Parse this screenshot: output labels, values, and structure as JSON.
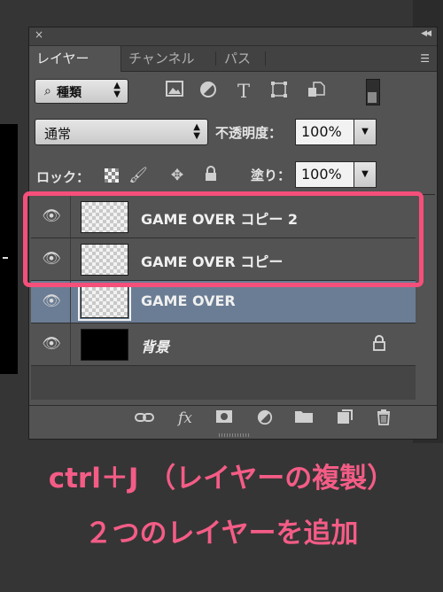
{
  "panel": {
    "close_glyph": "×",
    "collapse_glyph": "◀◀",
    "menu_glyph": "☰",
    "tabs": [
      {
        "label": "レイヤー",
        "active": true
      },
      {
        "label": "チャンネル",
        "active": false
      },
      {
        "label": "パス",
        "active": false
      }
    ],
    "filter": {
      "label": "種類",
      "icon": "magnifier-icon"
    },
    "filter_icons": [
      "image-filter-icon",
      "adjustment-filter-icon",
      "type-filter-icon",
      "shape-filter-icon",
      "smart-object-filter-icon"
    ],
    "blend_mode": "通常",
    "opacity_label": "不透明度：",
    "opacity_value": "100%",
    "lock_label": "ロック：",
    "fill_label": "塗り：",
    "fill_value": "100%",
    "layers": [
      {
        "name": "GAME OVER コピー 2",
        "thumbnail": "transparent",
        "selected": false,
        "locked": false
      },
      {
        "name": "GAME OVER コピー",
        "thumbnail": "transparent",
        "selected": false,
        "locked": false
      },
      {
        "name": "GAME OVER",
        "thumbnail": "transparent",
        "selected": true,
        "locked": false
      },
      {
        "name": "背景",
        "thumbnail": "black",
        "selected": false,
        "locked": true
      }
    ],
    "bottom_icons": [
      "link-icon",
      "fx-icon",
      "mask-icon",
      "adjustment-icon",
      "group-folder-icon",
      "new-layer-icon",
      "trash-icon"
    ],
    "fx_label": "fx"
  },
  "annotation": {
    "line1": "ctrl＋J （レイヤーの複製）",
    "line2": "２つのレイヤーを追加",
    "color": "#f45c86"
  }
}
